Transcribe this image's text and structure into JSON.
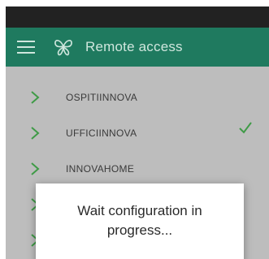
{
  "app_bar": {
    "title": "Remote access",
    "background": "#1f7a5f",
    "icons": {
      "menu": "hamburger-menu-icon",
      "logo": "butterfly-logo-icon"
    }
  },
  "sites": [
    {
      "label": "OSPITIINNOVA",
      "icon": "chevron-right-icon"
    },
    {
      "label": "UFFICIINNOVA",
      "icon": "chevron-right-icon"
    },
    {
      "label": "INNOVAHOME",
      "icon": "chevron-right-icon"
    },
    {
      "label": "",
      "icon": "chevron-right-icon"
    },
    {
      "label": "",
      "icon": "chevron-right-icon"
    }
  ],
  "dialog": {
    "message_line1": "Wait configuration in",
    "message_line2": "progress..."
  },
  "colors": {
    "accent": "#1f7a5f",
    "chevron": "#3f9b47",
    "overlay_background": "#bdbdbd"
  }
}
